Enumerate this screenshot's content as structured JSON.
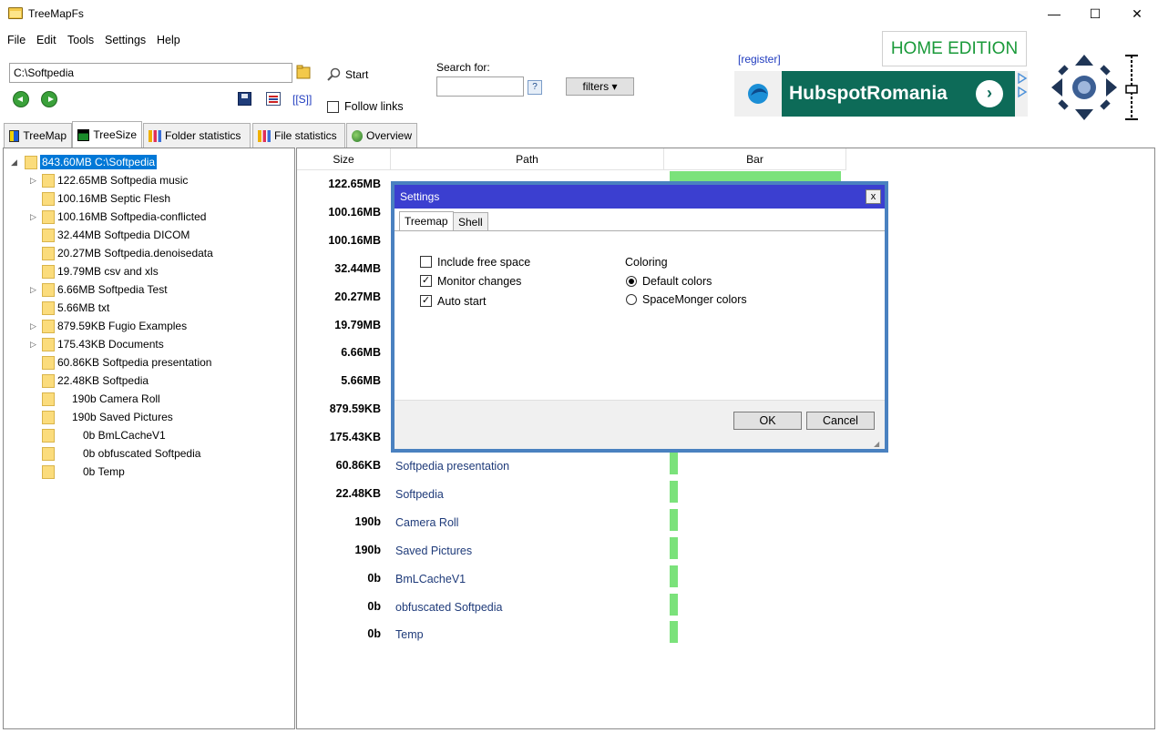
{
  "window": {
    "title": "TreeMapFs",
    "minimize": "—",
    "maximize": "☐",
    "close": "✕"
  },
  "menu": [
    "File",
    "Edit",
    "Tools",
    "Settings",
    "Help"
  ],
  "toolbar": {
    "path_value": "C:\\Softpedia",
    "start_label": "Start",
    "search_label": "Search for:",
    "search_value": "",
    "search_help": "?",
    "filters_label": "filters ▾",
    "s_link": "[[S]]",
    "follow_links_label": "Follow links",
    "follow_links_checked": false
  },
  "ad": {
    "register_link": "[register]",
    "home_edition": "HOME EDITION",
    "banner_text": "HubspotRomania",
    "arrow": "›"
  },
  "tabs": [
    {
      "label": "TreeMap",
      "icon": "treemap-icon",
      "active": false
    },
    {
      "label": "TreeSize",
      "icon": "treesize-icon",
      "active": true
    },
    {
      "label": "Folder statistics",
      "icon": "bar-chart-icon",
      "active": false
    },
    {
      "label": "File statistics",
      "icon": "bar-chart-icon",
      "active": false
    },
    {
      "label": "Overview",
      "icon": "overview-icon",
      "active": false
    }
  ],
  "tree": {
    "root": "843.60MB C:\\Softpedia",
    "items": [
      {
        "label": "122.65MB Softpedia music",
        "expandable": true
      },
      {
        "label": "100.16MB Septic Flesh",
        "expandable": false
      },
      {
        "label": "100.16MB Softpedia-conflicted",
        "expandable": true
      },
      {
        "label": "32.44MB Softpedia DICOM",
        "expandable": false
      },
      {
        "label": "20.27MB Softpedia.denoisedata",
        "expandable": false
      },
      {
        "label": "19.79MB csv and xls",
        "expandable": false
      },
      {
        "label": "6.66MB Softpedia Test",
        "expandable": true
      },
      {
        "label": "5.66MB txt",
        "expandable": false
      },
      {
        "label": "879.59KB Fugio Examples",
        "expandable": true
      },
      {
        "label": "175.43KB Documents",
        "expandable": true
      },
      {
        "label": "60.86KB Softpedia presentation",
        "expandable": false
      },
      {
        "label": "22.48KB Softpedia",
        "expandable": false
      },
      {
        "label": "190b Camera Roll",
        "expandable": false
      },
      {
        "label": "190b Saved Pictures",
        "expandable": false
      },
      {
        "label": "0b BmLCacheV1",
        "expandable": false
      },
      {
        "label": "0b obfuscated Softpedia",
        "expandable": false
      },
      {
        "label": "0b Temp",
        "expandable": false
      }
    ]
  },
  "grid": {
    "headers": [
      "Size",
      "Path",
      "Bar"
    ],
    "rows": [
      {
        "size": "122.65MB",
        "path": "",
        "bar": 1.0
      },
      {
        "size": "100.16MB",
        "path": "",
        "bar": 0.8
      },
      {
        "size": "100.16MB",
        "path": "",
        "bar": 0.8
      },
      {
        "size": "32.44MB",
        "path": "",
        "bar": 0.3
      },
      {
        "size": "20.27MB",
        "path": "",
        "bar": 0.2
      },
      {
        "size": "19.79MB",
        "path": "",
        "bar": 0.2
      },
      {
        "size": "6.66MB",
        "path": "",
        "bar": 0.05
      },
      {
        "size": "5.66MB",
        "path": "",
        "bar": 0.05
      },
      {
        "size": "879.59KB",
        "path": "",
        "bar": 0.05
      },
      {
        "size": "175.43KB",
        "path": "",
        "bar": 0.05
      },
      {
        "size": "60.86KB",
        "path": "Softpedia presentation",
        "bar": 0.05
      },
      {
        "size": "22.48KB",
        "path": "Softpedia",
        "bar": 0.05
      },
      {
        "size": "190b",
        "path": "Camera Roll",
        "bar": 0.05
      },
      {
        "size": "190b",
        "path": "Saved Pictures",
        "bar": 0.05
      },
      {
        "size": "0b",
        "path": "BmLCacheV1",
        "bar": 0.05
      },
      {
        "size": "0b",
        "path": "obfuscated Softpedia",
        "bar": 0.05
      },
      {
        "size": "0b",
        "path": "Temp",
        "bar": 0.05
      }
    ]
  },
  "dialog": {
    "title": "Settings",
    "close": "x",
    "tabs": [
      "Treemap",
      "Shell"
    ],
    "include_free_space": "Include free space",
    "monitor_changes": "Monitor changes",
    "auto_start": "Auto start",
    "coloring_label": "Coloring",
    "default_colors": "Default colors",
    "spacemonger_colors": "SpaceMonger colors",
    "ok": "OK",
    "cancel": "Cancel",
    "check": "✓"
  },
  "colors": {
    "selection": "#0078d7",
    "bar": "#7be27b",
    "dialog_title": "#3b3fd0",
    "ad_green": "#0d6b58",
    "home_edition": "#1a9a3a"
  }
}
